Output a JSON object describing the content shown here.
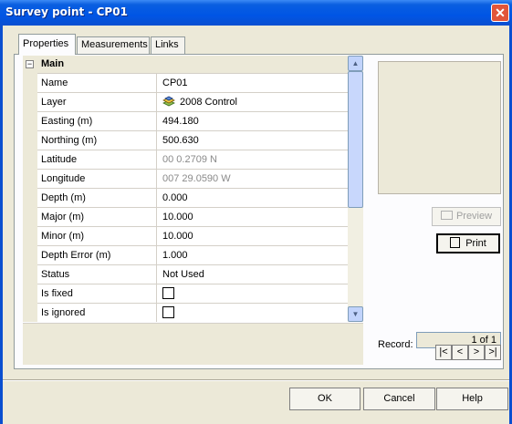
{
  "window": {
    "title": "Survey point - CP01",
    "close_glyph": "✕"
  },
  "tabs": [
    {
      "label": "Properties",
      "active": true
    },
    {
      "label": "Measurements",
      "active": false
    },
    {
      "label": "Links",
      "active": false
    }
  ],
  "grid": {
    "group_label": "Main",
    "expander_glyph": "−",
    "rows": [
      {
        "label": "Name",
        "value": "CP01"
      },
      {
        "label": "Layer",
        "value": "2008 Control",
        "icon": "layer-icon"
      },
      {
        "label": "Easting (m)",
        "value": "494.180"
      },
      {
        "label": "Northing (m)",
        "value": "500.630"
      },
      {
        "label": "Latitude",
        "value": "00 0.2709 N",
        "muted": true
      },
      {
        "label": "Longitude",
        "value": "007 29.0590 W",
        "muted": true
      },
      {
        "label": "Depth (m)",
        "value": "0.000"
      },
      {
        "label": "Major (m)",
        "value": "10.000"
      },
      {
        "label": "Minor (m)",
        "value": "10.000"
      },
      {
        "label": "Depth Error (m)",
        "value": "1.000"
      },
      {
        "label": "Status",
        "value": "Not Used"
      },
      {
        "label": "Is fixed",
        "checkbox": false
      },
      {
        "label": "Is ignored",
        "checkbox": false
      }
    ]
  },
  "side": {
    "preview_label": "Preview",
    "print_label": "Print",
    "record_label": "Record:",
    "record_value": "1 of 1",
    "nav": [
      "|<",
      "<",
      ">",
      ">|"
    ]
  },
  "footer": {
    "ok_label": "OK",
    "cancel_label": "Cancel",
    "help_label": "Help"
  },
  "colors": {
    "titlebar": "#0055e5",
    "dialog_bg": "#ece9d8"
  }
}
